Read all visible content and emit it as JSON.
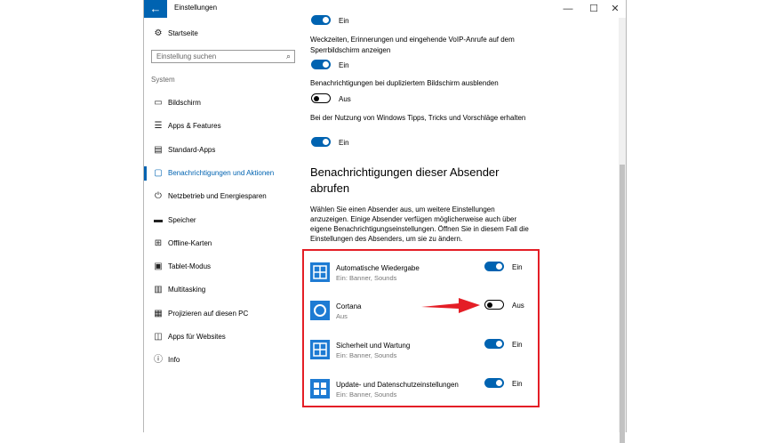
{
  "window": {
    "title": "Einstellungen",
    "back_icon": "back-arrow-icon",
    "minimize": "—",
    "maximize": "☐",
    "close": "✕"
  },
  "sidebar": {
    "home_label": "Startseite",
    "search_placeholder": "Einstellung suchen",
    "section": "System",
    "items": [
      {
        "label": "Bildschirm",
        "icon": "monitor-icon"
      },
      {
        "label": "Apps & Features",
        "icon": "list-icon"
      },
      {
        "label": "Standard-Apps",
        "icon": "default-apps-icon"
      },
      {
        "label": "Benachrichtigungen und Aktionen",
        "icon": "message-icon"
      },
      {
        "label": "Netzbetrieb und Energiesparen",
        "icon": "power-icon"
      },
      {
        "label": "Speicher",
        "icon": "storage-icon"
      },
      {
        "label": "Offline-Karten",
        "icon": "map-icon"
      },
      {
        "label": "Tablet-Modus",
        "icon": "tablet-icon"
      },
      {
        "label": "Multitasking",
        "icon": "multitasking-icon"
      },
      {
        "label": "Projizieren auf diesen PC",
        "icon": "project-icon"
      },
      {
        "label": "Apps für Websites",
        "icon": "web-apps-icon"
      },
      {
        "label": "Info",
        "icon": "info-icon"
      }
    ]
  },
  "settings": {
    "top_toggle_state": "Ein",
    "lockscreen_voip": {
      "desc": "Weckzeiten, Erinnerungen und eingehende VoIP-Anrufe auf dem Sperrbildschirm anzeigen",
      "state": "Ein"
    },
    "duplicate_screen": {
      "desc": "Benachrichtigungen bei dupliziertem Bildschirm ausblenden",
      "state": "Aus"
    },
    "windows_tips": {
      "desc": "Bei der Nutzung von Windows Tipps, Tricks und Vorschläge erhalten",
      "state": "Ein"
    }
  },
  "senders": {
    "heading": "Benachrichtigungen dieser Absender abrufen",
    "info": "Wählen Sie einen Absender aus, um weitere Einstellungen anzuzeigen. Einige Absender verfügen möglicherweise auch über eigene Benachrichtigungseinstellungen. Öffnen Sie in diesem Fall die Einstellungen des Absenders, um sie zu ändern.",
    "apps": [
      {
        "name": "Automatische Wiedergabe",
        "sub": "Ein: Banner, Sounds",
        "state": "Ein",
        "on": true,
        "icon": "autoplay-icon"
      },
      {
        "name": "Cortana",
        "sub": "Aus",
        "state": "Aus",
        "on": false,
        "icon": "cortana-icon"
      },
      {
        "name": "Sicherheit und Wartung",
        "sub": "Ein: Banner, Sounds",
        "state": "Ein",
        "on": true,
        "icon": "security-maintenance-icon"
      },
      {
        "name": "Update- und Datenschutzeinstellungen",
        "sub": "Ein: Banner, Sounds",
        "state": "Ein",
        "on": true,
        "icon": "windows-update-icon"
      }
    ]
  },
  "colors": {
    "accent": "#0063b1",
    "highlight_box": "#e41e26",
    "arrow": "#e41e26"
  }
}
